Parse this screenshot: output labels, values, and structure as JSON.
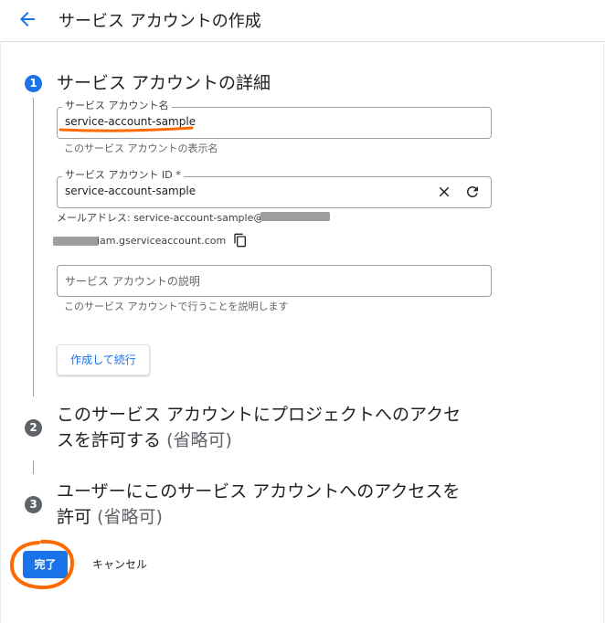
{
  "header": {
    "title": "サービス アカウントの作成"
  },
  "steps": [
    {
      "number": "1",
      "title": "サービス アカウントの詳細"
    },
    {
      "number": "2",
      "title_line1": "このサービス アカウントにプロジェクトへのアクセ",
      "title_line2": "スを許可する",
      "optional": "(省略可)"
    },
    {
      "number": "3",
      "title_line1": "ユーザーにこのサービス アカウントへのアクセスを",
      "title_line2": "許可",
      "optional": "(省略可)"
    }
  ],
  "form": {
    "name_field": {
      "label": "サービス アカウント名",
      "value": "service-account-sample",
      "helper": "このサービス アカウントの表示名"
    },
    "id_field": {
      "label": "サービス アカウント ID *",
      "value": "service-account-sample"
    },
    "email": {
      "prefix": "メールアドレス: service-account-sample@",
      "suffix": "iam.gserviceaccount.com"
    },
    "description_field": {
      "placeholder": "サービス アカウントの説明",
      "helper": "このサービス アカウントで行うことを説明します"
    },
    "continue_label": "作成して続行"
  },
  "actions": {
    "done_label": "完了",
    "cancel_label": "キャンセル"
  },
  "colors": {
    "accent": "#1a73e8",
    "annotation": "#ff6a00"
  },
  "icons": [
    "arrow-left-icon",
    "close-icon",
    "refresh-icon",
    "copy-icon"
  ]
}
